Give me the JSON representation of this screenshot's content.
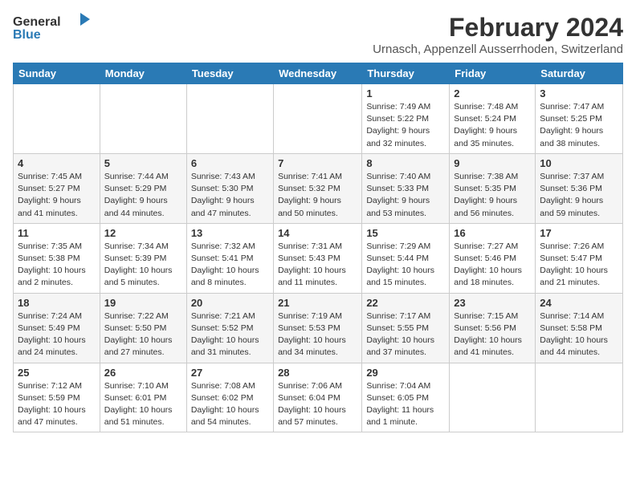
{
  "logo": {
    "general": "General",
    "blue": "Blue"
  },
  "title": "February 2024",
  "subtitle": "Urnasch, Appenzell Ausserrhoden, Switzerland",
  "weekdays": [
    "Sunday",
    "Monday",
    "Tuesday",
    "Wednesday",
    "Thursday",
    "Friday",
    "Saturday"
  ],
  "weeks": [
    [
      {
        "day": "",
        "info": ""
      },
      {
        "day": "",
        "info": ""
      },
      {
        "day": "",
        "info": ""
      },
      {
        "day": "",
        "info": ""
      },
      {
        "day": "1",
        "info": "Sunrise: 7:49 AM\nSunset: 5:22 PM\nDaylight: 9 hours\nand 32 minutes."
      },
      {
        "day": "2",
        "info": "Sunrise: 7:48 AM\nSunset: 5:24 PM\nDaylight: 9 hours\nand 35 minutes."
      },
      {
        "day": "3",
        "info": "Sunrise: 7:47 AM\nSunset: 5:25 PM\nDaylight: 9 hours\nand 38 minutes."
      }
    ],
    [
      {
        "day": "4",
        "info": "Sunrise: 7:45 AM\nSunset: 5:27 PM\nDaylight: 9 hours\nand 41 minutes."
      },
      {
        "day": "5",
        "info": "Sunrise: 7:44 AM\nSunset: 5:29 PM\nDaylight: 9 hours\nand 44 minutes."
      },
      {
        "day": "6",
        "info": "Sunrise: 7:43 AM\nSunset: 5:30 PM\nDaylight: 9 hours\nand 47 minutes."
      },
      {
        "day": "7",
        "info": "Sunrise: 7:41 AM\nSunset: 5:32 PM\nDaylight: 9 hours\nand 50 minutes."
      },
      {
        "day": "8",
        "info": "Sunrise: 7:40 AM\nSunset: 5:33 PM\nDaylight: 9 hours\nand 53 minutes."
      },
      {
        "day": "9",
        "info": "Sunrise: 7:38 AM\nSunset: 5:35 PM\nDaylight: 9 hours\nand 56 minutes."
      },
      {
        "day": "10",
        "info": "Sunrise: 7:37 AM\nSunset: 5:36 PM\nDaylight: 9 hours\nand 59 minutes."
      }
    ],
    [
      {
        "day": "11",
        "info": "Sunrise: 7:35 AM\nSunset: 5:38 PM\nDaylight: 10 hours\nand 2 minutes."
      },
      {
        "day": "12",
        "info": "Sunrise: 7:34 AM\nSunset: 5:39 PM\nDaylight: 10 hours\nand 5 minutes."
      },
      {
        "day": "13",
        "info": "Sunrise: 7:32 AM\nSunset: 5:41 PM\nDaylight: 10 hours\nand 8 minutes."
      },
      {
        "day": "14",
        "info": "Sunrise: 7:31 AM\nSunset: 5:43 PM\nDaylight: 10 hours\nand 11 minutes."
      },
      {
        "day": "15",
        "info": "Sunrise: 7:29 AM\nSunset: 5:44 PM\nDaylight: 10 hours\nand 15 minutes."
      },
      {
        "day": "16",
        "info": "Sunrise: 7:27 AM\nSunset: 5:46 PM\nDaylight: 10 hours\nand 18 minutes."
      },
      {
        "day": "17",
        "info": "Sunrise: 7:26 AM\nSunset: 5:47 PM\nDaylight: 10 hours\nand 21 minutes."
      }
    ],
    [
      {
        "day": "18",
        "info": "Sunrise: 7:24 AM\nSunset: 5:49 PM\nDaylight: 10 hours\nand 24 minutes."
      },
      {
        "day": "19",
        "info": "Sunrise: 7:22 AM\nSunset: 5:50 PM\nDaylight: 10 hours\nand 27 minutes."
      },
      {
        "day": "20",
        "info": "Sunrise: 7:21 AM\nSunset: 5:52 PM\nDaylight: 10 hours\nand 31 minutes."
      },
      {
        "day": "21",
        "info": "Sunrise: 7:19 AM\nSunset: 5:53 PM\nDaylight: 10 hours\nand 34 minutes."
      },
      {
        "day": "22",
        "info": "Sunrise: 7:17 AM\nSunset: 5:55 PM\nDaylight: 10 hours\nand 37 minutes."
      },
      {
        "day": "23",
        "info": "Sunrise: 7:15 AM\nSunset: 5:56 PM\nDaylight: 10 hours\nand 41 minutes."
      },
      {
        "day": "24",
        "info": "Sunrise: 7:14 AM\nSunset: 5:58 PM\nDaylight: 10 hours\nand 44 minutes."
      }
    ],
    [
      {
        "day": "25",
        "info": "Sunrise: 7:12 AM\nSunset: 5:59 PM\nDaylight: 10 hours\nand 47 minutes."
      },
      {
        "day": "26",
        "info": "Sunrise: 7:10 AM\nSunset: 6:01 PM\nDaylight: 10 hours\nand 51 minutes."
      },
      {
        "day": "27",
        "info": "Sunrise: 7:08 AM\nSunset: 6:02 PM\nDaylight: 10 hours\nand 54 minutes."
      },
      {
        "day": "28",
        "info": "Sunrise: 7:06 AM\nSunset: 6:04 PM\nDaylight: 10 hours\nand 57 minutes."
      },
      {
        "day": "29",
        "info": "Sunrise: 7:04 AM\nSunset: 6:05 PM\nDaylight: 11 hours\nand 1 minute."
      },
      {
        "day": "",
        "info": ""
      },
      {
        "day": "",
        "info": ""
      }
    ]
  ]
}
